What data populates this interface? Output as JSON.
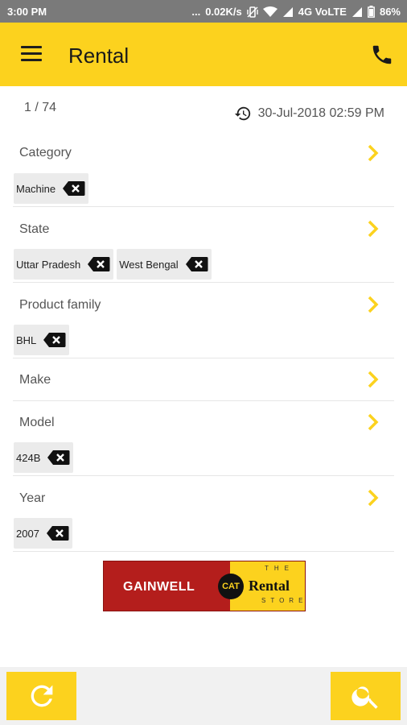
{
  "status_bar": {
    "time": "3:00 PM",
    "dots": "...",
    "speed": "0.02K/s",
    "network": "4G VoLTE",
    "battery": "86%"
  },
  "app_bar": {
    "title": "Rental",
    "menu_icon": "hamburger-menu-icon",
    "phone_icon": "phone-icon"
  },
  "meta": {
    "counter": "1 / 74",
    "timestamp": "30-Jul-2018 02:59 PM",
    "history_icon": "history-icon"
  },
  "filters": [
    {
      "label": "Category",
      "chips": [
        "Machine"
      ]
    },
    {
      "label": "State",
      "chips": [
        "Uttar Pradesh",
        "West Bengal"
      ]
    },
    {
      "label": "Product family",
      "chips": [
        "BHL"
      ]
    },
    {
      "label": "Make",
      "chips": []
    },
    {
      "label": "Model",
      "chips": [
        "424B"
      ]
    },
    {
      "label": "Year",
      "chips": [
        "2007"
      ]
    }
  ],
  "banner": {
    "gainwell": "GAINWELL",
    "cat": "CAT",
    "the": "THE",
    "rental": "Rental",
    "store": "STORE"
  },
  "bottom_bar": {
    "refresh_icon": "refresh-icon",
    "search_icon": "search-icon"
  },
  "colors": {
    "accent": "#fcd21e",
    "status_bar": "#7a7a7a",
    "chip_bg": "#ebebeb",
    "banner_red": "#b41e1c"
  }
}
